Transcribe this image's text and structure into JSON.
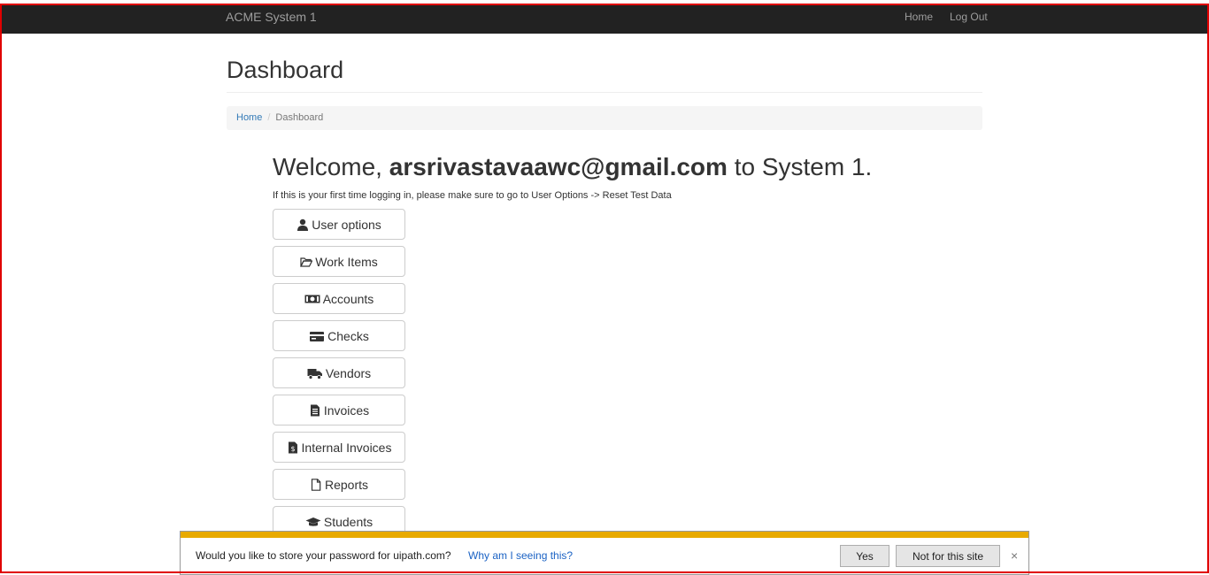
{
  "navbar": {
    "brand": "ACME System 1",
    "links": [
      "Home",
      "Log Out"
    ]
  },
  "page": {
    "title": "Dashboard"
  },
  "breadcrumb": {
    "home": "Home",
    "separator": "/",
    "current": "Dashboard"
  },
  "welcome": {
    "prefix": "Welcome, ",
    "user": "arsrivastavaawc@gmail.com",
    "suffix": " to System 1.",
    "notice": "If this is your first time logging in, please make sure to go to User Options -> Reset Test Data"
  },
  "menu": [
    {
      "label": "User options",
      "icon": "user-icon"
    },
    {
      "label": "Work Items",
      "icon": "folder-open-icon"
    },
    {
      "label": "Accounts",
      "icon": "money-icon"
    },
    {
      "label": "Checks",
      "icon": "credit-card-icon"
    },
    {
      "label": "Vendors",
      "icon": "truck-icon"
    },
    {
      "label": "Invoices",
      "icon": "invoice-icon"
    },
    {
      "label": "Internal Invoices",
      "icon": "file-invoice-icon"
    },
    {
      "label": "Reports",
      "icon": "file-icon"
    },
    {
      "label": "Students",
      "icon": "graduation-cap-icon"
    }
  ],
  "password_bar": {
    "message": "Would you like to store your password for uipath.com?",
    "link": "Why am I seeing this?",
    "yes": "Yes",
    "no": "Not for this site",
    "close": "×",
    "accent_color": "#e8aa00"
  },
  "colors": {
    "navbar": "#222222",
    "link": "#337ab7",
    "frame_border": "#e00000"
  }
}
